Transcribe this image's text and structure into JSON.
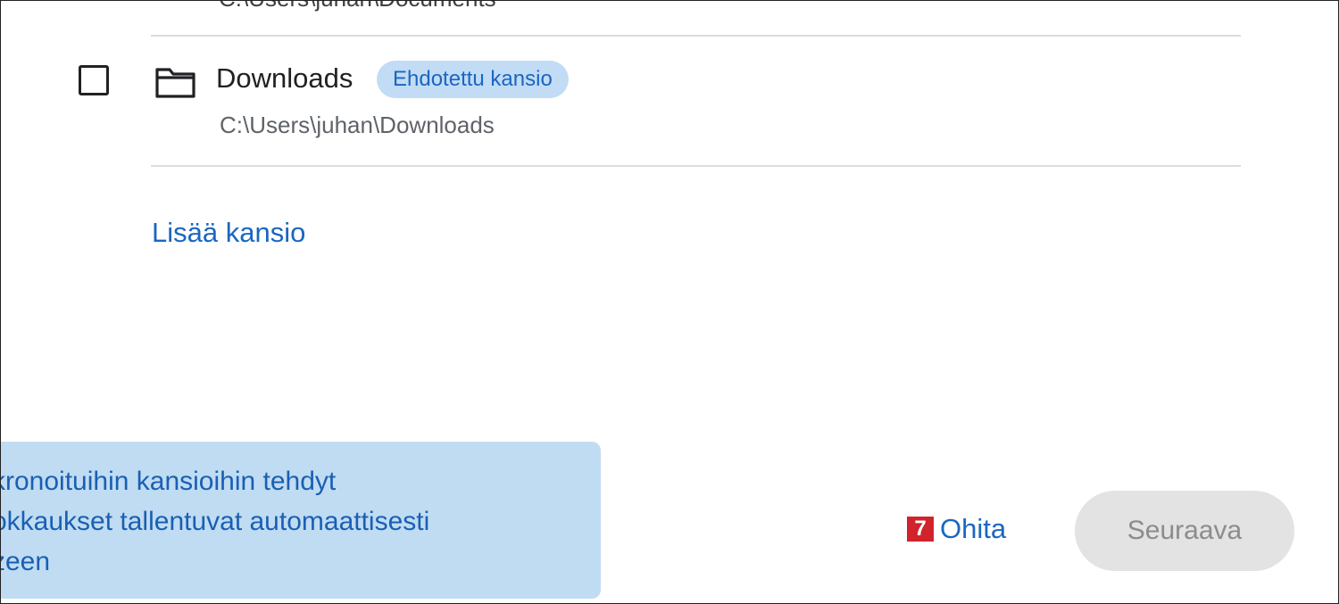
{
  "previous_item": {
    "path_partial": "C:\\Users\\juhan\\Documents"
  },
  "folder_item": {
    "name": "Downloads",
    "chip_label": "Ehdotettu kansio",
    "path": "C:\\Users\\juhan\\Downloads",
    "checked": false,
    "icon": "folder-icon"
  },
  "add_folder_label": "Lisää kansio",
  "tooltip": {
    "lines": [
      "kronoituihin kansioihin tehdyt",
      "okkaukset tallentuvat automaattisesti",
      "zeen"
    ]
  },
  "footer": {
    "skip_badge": "7",
    "skip_label": "Ohita",
    "next_label": "Seuraava",
    "next_disabled": true
  },
  "colors": {
    "accent": "#1a66c2",
    "chip_bg": "#c2dcf5",
    "tooltip_bg": "#c0dcf2",
    "badge": "#d0232c",
    "disabled_bg": "#e3e3e3",
    "disabled_text": "#8c8c8c"
  }
}
